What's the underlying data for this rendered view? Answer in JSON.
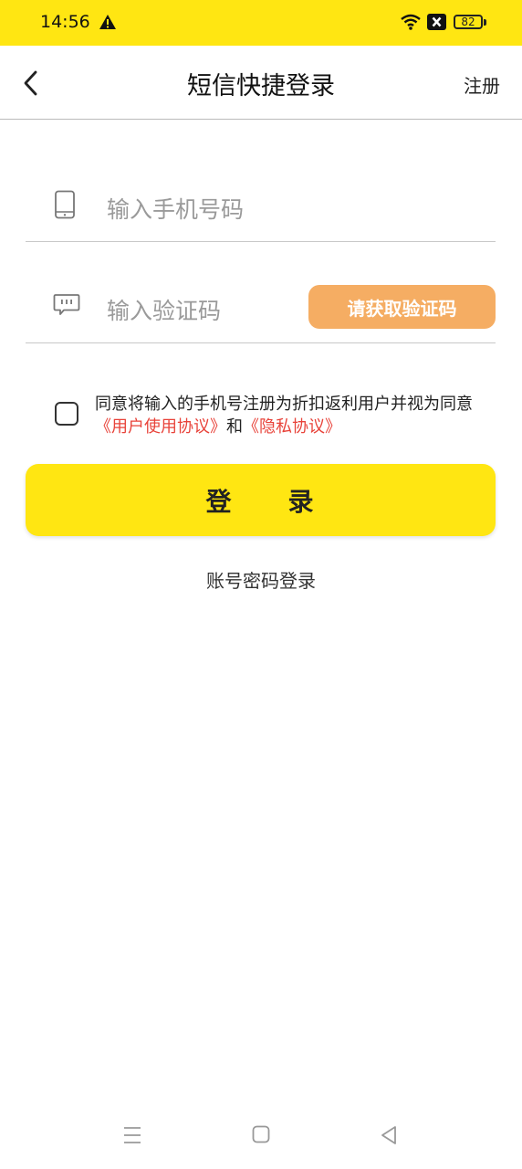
{
  "status_bar": {
    "time": "14:56",
    "battery": "82",
    "icons": [
      "warning-icon",
      "wifi-icon",
      "x-badge-icon",
      "battery-icon"
    ]
  },
  "header": {
    "title": "短信快捷登录",
    "right_link": "注册",
    "back_icon": "chevron-left-icon"
  },
  "form": {
    "phone": {
      "placeholder": "输入手机号码",
      "value": "",
      "icon": "phone-icon"
    },
    "code": {
      "placeholder": "输入验证码",
      "value": "",
      "icon": "message-icon",
      "button": "请获取验证码"
    }
  },
  "agreement": {
    "checked": false,
    "text_prefix": "同意将输入的手机号注册为折扣返利用户并视为同意",
    "link_user": "《用户使用协议》",
    "text_and": "和",
    "link_privacy": "《隐私协议》"
  },
  "login_button": "登　　录",
  "password_login": "账号密码登录",
  "colors": {
    "accent_yellow": "#ffe612",
    "code_button": "#f5ad63",
    "link_red": "#e8433a"
  },
  "nav_bar": {
    "icons": [
      "menu-icon",
      "home-icon",
      "back-icon"
    ]
  }
}
